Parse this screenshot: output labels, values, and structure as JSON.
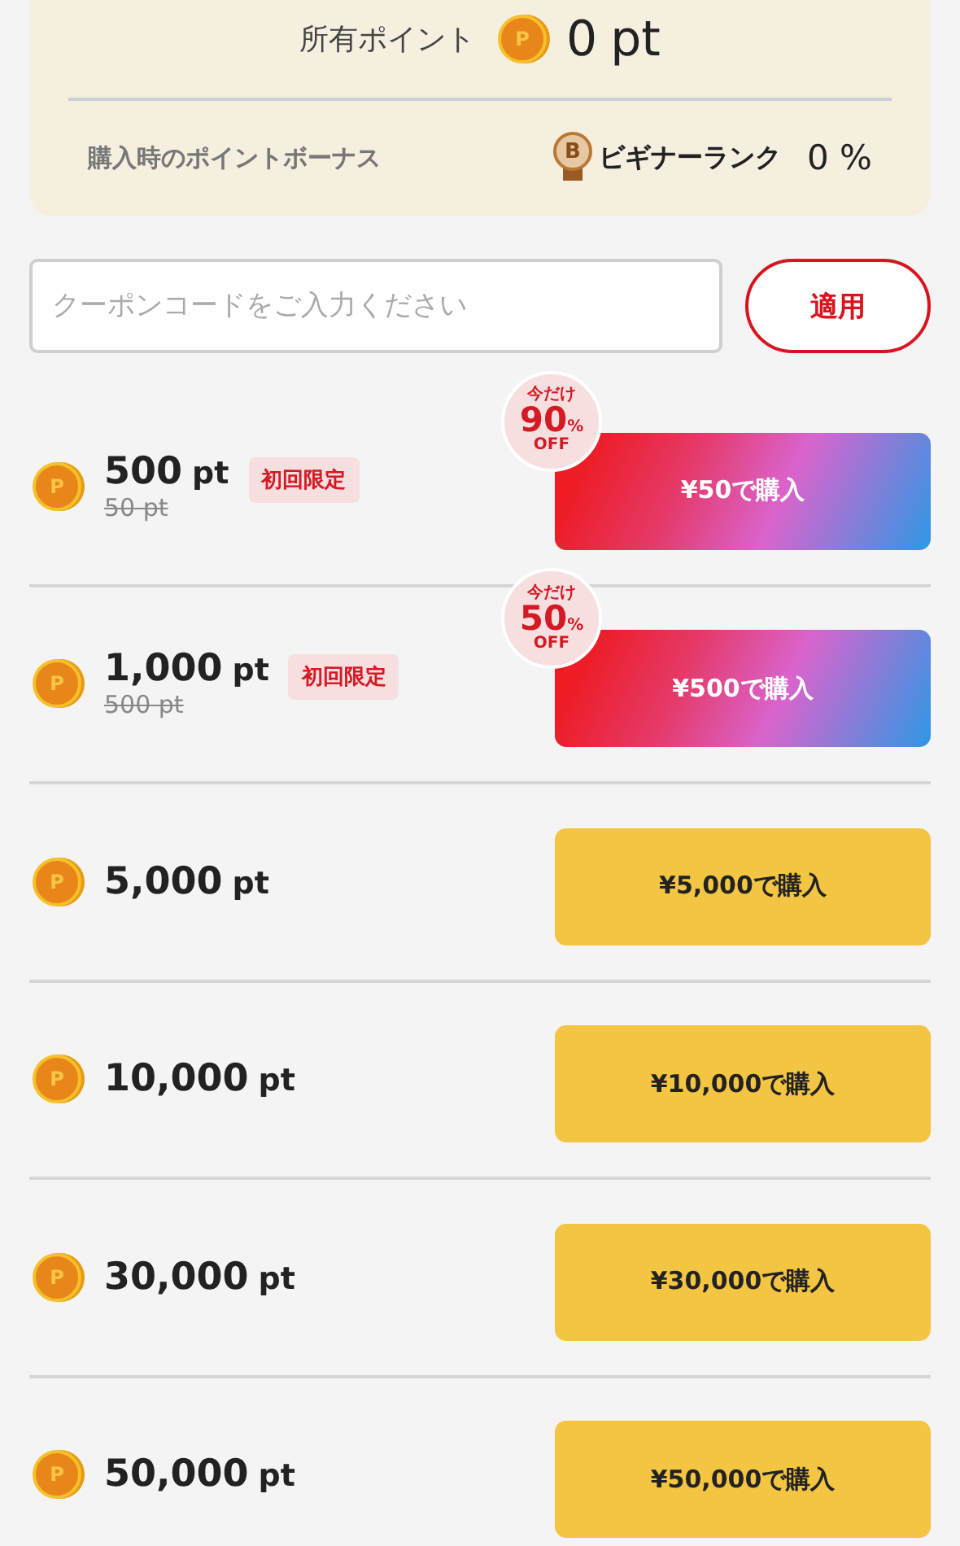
{
  "balance": {
    "label": "所有ポイント",
    "coin_mark": "P",
    "amount": "0",
    "unit": "pt"
  },
  "bonus": {
    "label": "購入時のポイントボーナス",
    "rank_mark": "B",
    "rank": "ビギナーランク",
    "rate": "0 %"
  },
  "coupon": {
    "placeholder": "クーポンコードをご入力ください",
    "apply": "適用"
  },
  "packages": [
    {
      "kind": "sale",
      "coin_mark": "P",
      "points": "500",
      "unit": "pt",
      "original": "50 pt",
      "tag": "初回限定",
      "discount": {
        "top": "今だけ",
        "value": "90",
        "pct": "%",
        "off": "OFF"
      },
      "price": "¥50で購入"
    },
    {
      "kind": "sale",
      "coin_mark": "P",
      "points": "1,000",
      "unit": "pt",
      "original": "500 pt",
      "tag": "初回限定",
      "discount": {
        "top": "今だけ",
        "value": "50",
        "pct": "%",
        "off": "OFF"
      },
      "price": "¥500で購入"
    },
    {
      "kind": "regular",
      "coin_mark": "P",
      "points": "5,000",
      "unit": "pt",
      "price": "¥5,000で購入"
    },
    {
      "kind": "regular",
      "coin_mark": "P",
      "points": "10,000",
      "unit": "pt",
      "price": "¥10,000で購入"
    },
    {
      "kind": "regular",
      "coin_mark": "P",
      "points": "30,000",
      "unit": "pt",
      "price": "¥30,000で購入"
    },
    {
      "kind": "regular",
      "coin_mark": "P",
      "points": "50,000",
      "unit": "pt",
      "price": "¥50,000で購入"
    }
  ]
}
